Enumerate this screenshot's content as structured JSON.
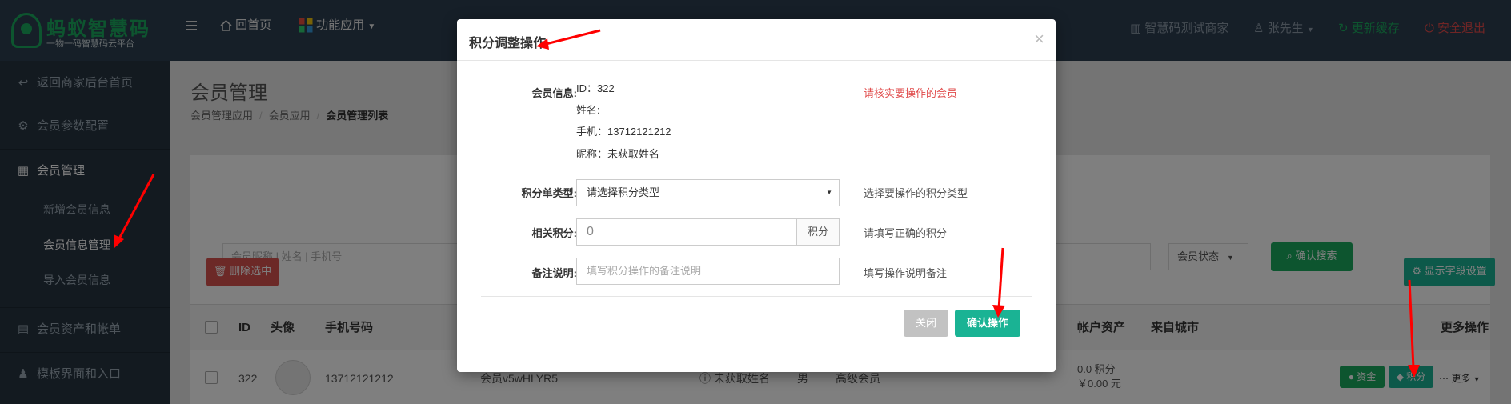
{
  "brand": {
    "name": "蚂蚁智慧码",
    "tagline": "一物一码智慧码云平台"
  },
  "topnav": {
    "menu_icon": "hamburger-icon",
    "home": "回首页",
    "apps": "功能应用"
  },
  "topright": {
    "store": "智慧码测试商家",
    "user": "张先生",
    "refresh": "更新缓存",
    "logout": "安全退出"
  },
  "sidebar": {
    "items": [
      {
        "label": "返回商家后台首页",
        "icon": "reply-icon"
      },
      {
        "label": "会员参数配置",
        "icon": "gear-icon"
      },
      {
        "label": "会员管理",
        "icon": "grid-icon"
      },
      {
        "label": "会员资产和帐单",
        "icon": "clipboard-icon"
      },
      {
        "label": "模板界面和入口",
        "icon": "shirt-icon"
      }
    ],
    "sub_items": [
      "新增会员信息",
      "会员信息管理",
      "导入会员信息"
    ]
  },
  "page": {
    "title": "会员管理",
    "breadcrumbs": [
      "会员管理应用",
      "会员应用",
      "会员管理列表"
    ]
  },
  "toolbar": {
    "search_placeholder": "会员昵称 | 姓名 | 手机号",
    "status_select": "会员状态",
    "confirm_search": "确认搜索",
    "delete_selected": "删除选中",
    "field_settings": "显示字段设置"
  },
  "table": {
    "headers": [
      "ID",
      "头像",
      "手机号码",
      "帐户资产",
      "来自城市",
      "更多操作"
    ],
    "row": {
      "id": "322",
      "phone": "13712121212",
      "name": "会员v5wHLYR5",
      "nickname": "未获取姓名",
      "gender": "男",
      "level": "高级会员",
      "points": "0.0 积分",
      "money": "￥0.00 元",
      "btn_funds": "资金",
      "btn_points": "积分",
      "btn_more": "更多"
    }
  },
  "modal": {
    "title": "积分调整操作",
    "member_label": "会员信息:",
    "id_line": "ID：322",
    "name_line": "姓名:",
    "phone_line": "手机：13712121212",
    "nick_line": "昵称：未获取姓名",
    "verify_hint": "请核实要操作的会员",
    "type_label": "积分单类型:",
    "type_value": "请选择积分类型",
    "type_hint": "选择要操作的积分类型",
    "points_label": "相关积分:",
    "points_value": "0",
    "points_unit": "积分",
    "points_hint": "请填写正确的积分",
    "remark_label": "备注说明:",
    "remark_placeholder": "填写积分操作的备注说明",
    "remark_hint": "填写操作说明备注",
    "close_btn": "关闭",
    "confirm_btn": "确认操作"
  },
  "colors": {
    "accent_green": "#1aab5e",
    "teal": "#1ab394",
    "danger": "#d9534f",
    "annotation_red": "#ff0000",
    "topbar": "#2d3e50",
    "sidebar": "#263441"
  }
}
